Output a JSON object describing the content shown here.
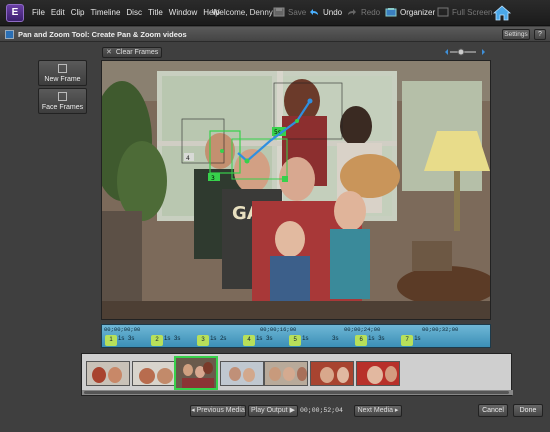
{
  "app": {
    "logo": "E",
    "menus": [
      "File",
      "Edit",
      "Clip",
      "Timeline",
      "Disc",
      "Title",
      "Window",
      "Help"
    ],
    "welcome": "Welcome, Denny",
    "toolbar": {
      "save": "Save",
      "undo": "Undo",
      "redo": "Redo",
      "organizer": "Organizer",
      "fullscreen": "Full Screen"
    }
  },
  "window": {
    "title": "Pan and Zoom Tool: Create Pan & Zoom videos",
    "settings": "Settings",
    "help": "?"
  },
  "sidebar": {
    "new_frame": "New Frame",
    "face_frames": "Face Frames"
  },
  "editor": {
    "clear_frames": "Clear Frames",
    "frame_labels": [
      "4",
      "3",
      "5",
      "1s"
    ]
  },
  "timeline": {
    "times": [
      "00;00;00;00",
      "00;00;16;00",
      "00;00;24;00",
      "00;00;32;00"
    ],
    "markers": [
      {
        "num": "1",
        "sec": "1s"
      },
      {
        "num": "",
        "sec": "3s"
      },
      {
        "num": "2",
        "sec": "1s"
      },
      {
        "num": "",
        "sec": "3s"
      },
      {
        "num": "3",
        "sec": "1s"
      },
      {
        "num": "",
        "sec": "2s"
      },
      {
        "num": "4",
        "sec": "1s"
      },
      {
        "num": "",
        "sec": "3s"
      },
      {
        "num": "5",
        "sec": "1s"
      },
      {
        "num": "",
        "sec": "3s"
      },
      {
        "num": "6",
        "sec": "1s"
      },
      {
        "num": "",
        "sec": "3s"
      },
      {
        "num": "7",
        "sec": "1s"
      }
    ]
  },
  "nav": {
    "previous": "Previous Media",
    "play": "Play Output",
    "timecode": "00;00;52;04",
    "next": "Next Media",
    "cancel": "Cancel",
    "done": "Done"
  },
  "colors": {
    "accent_green": "#37d14b",
    "timeline_blue": "#4a9fc4",
    "frame_line": "#2f8fe0"
  }
}
